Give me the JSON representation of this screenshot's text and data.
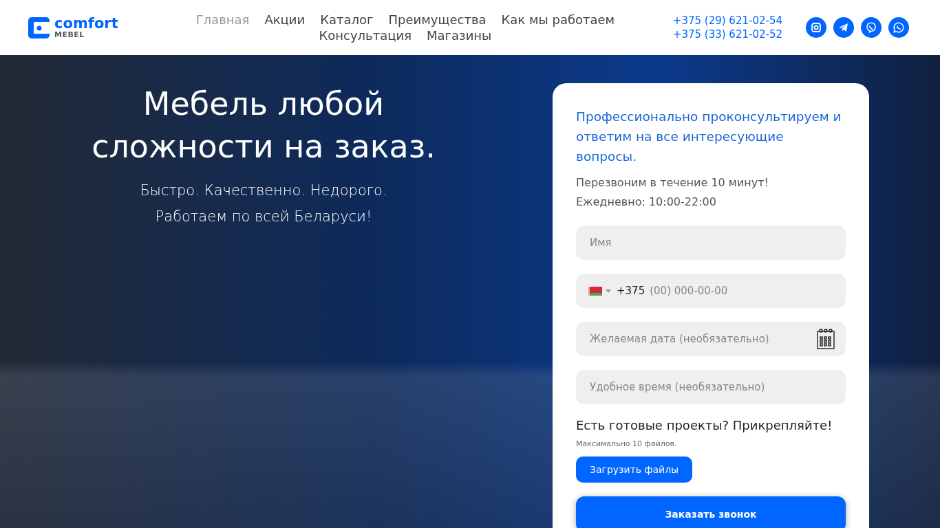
{
  "header": {
    "logo": {
      "name": "comfort",
      "sub": "MEBEL"
    },
    "nav": [
      {
        "label": "Главная",
        "selected": true
      },
      {
        "label": "Акции",
        "selected": false
      },
      {
        "label": "Каталог",
        "selected": false
      },
      {
        "label": "Преимущества",
        "selected": false
      },
      {
        "label": "Как мы работаем",
        "selected": false
      },
      {
        "label": "Консультация",
        "selected": false
      },
      {
        "label": "Магазины",
        "selected": false
      }
    ],
    "phones": [
      "+375 (29) 621-02-54",
      "+375 (33) 621-02-52"
    ],
    "socials": [
      {
        "kind": "instagram"
      },
      {
        "kind": "telegram"
      },
      {
        "kind": "viber"
      },
      {
        "kind": "whatsapp"
      }
    ]
  },
  "hero": {
    "title_lines": [
      "Мебель любой",
      "сложности на заказ."
    ],
    "subtitle_lines": [
      "Быстро. Качественно. Недорого.",
      "Работаем по всей Беларуси!"
    ]
  },
  "form": {
    "heading": "Профессионально проконсультируем и ответим на все интересующие вопросы.",
    "notes": [
      "Перезвоним в течение 10 минут!",
      "Ежедневно: 10:00-22:00"
    ],
    "fields": [
      {
        "kind": "text",
        "placeholder": "Имя"
      },
      {
        "kind": "phone",
        "prefix": "+375",
        "placeholder": "(00) 000-00-00"
      },
      {
        "kind": "date",
        "placeholder": "Желаемая дата (необязательно)"
      },
      {
        "kind": "text",
        "placeholder": "Удобное время (необязательно)"
      }
    ],
    "attach_title": "Есть готовые проекты? Прикрепляйте!",
    "attach_note": "Максимально 10 файлов.",
    "upload_button": "Загрузить файлы",
    "submit_button": "Заказать звонок"
  }
}
